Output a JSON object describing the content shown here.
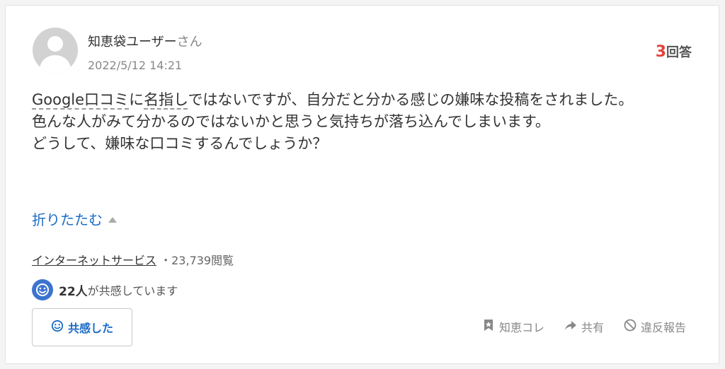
{
  "user": {
    "name": "知恵袋ユーザー",
    "suffix": "さん",
    "date": "2022/5/12 14:21"
  },
  "answers": {
    "count": "3",
    "unit": "回答"
  },
  "question": {
    "kw1": "Google口コミ",
    "t1": "に",
    "kw2": "名指し",
    "t2": "ではないですが、自分だと分かる感じの嫌味な投稿をされました。",
    "line2": "色んな人がみて分かるのではないかと思うと気持ちが落ち込んでしまいます。",
    "line3": "どうして、嫌味な口コミするんでしょうか？"
  },
  "collapse_label": "折りたたむ",
  "meta": {
    "category": "インターネットサービス",
    "separator": "・",
    "views": "23,739閲覧"
  },
  "empathy": {
    "count": "22人",
    "text": "が共感しています"
  },
  "empathize_button": "共感した",
  "actions": {
    "save": "知恵コレ",
    "share": "共有",
    "report": "違反報告"
  },
  "colors": {
    "accent": "#1a6bc6",
    "answer_count": "#e0443e",
    "empathy_badge": "#3c73cf"
  },
  "icons": [
    "avatar-icon",
    "smile-icon",
    "bookmark-icon",
    "share-arrow-icon",
    "report-icon",
    "caret-up-icon"
  ]
}
